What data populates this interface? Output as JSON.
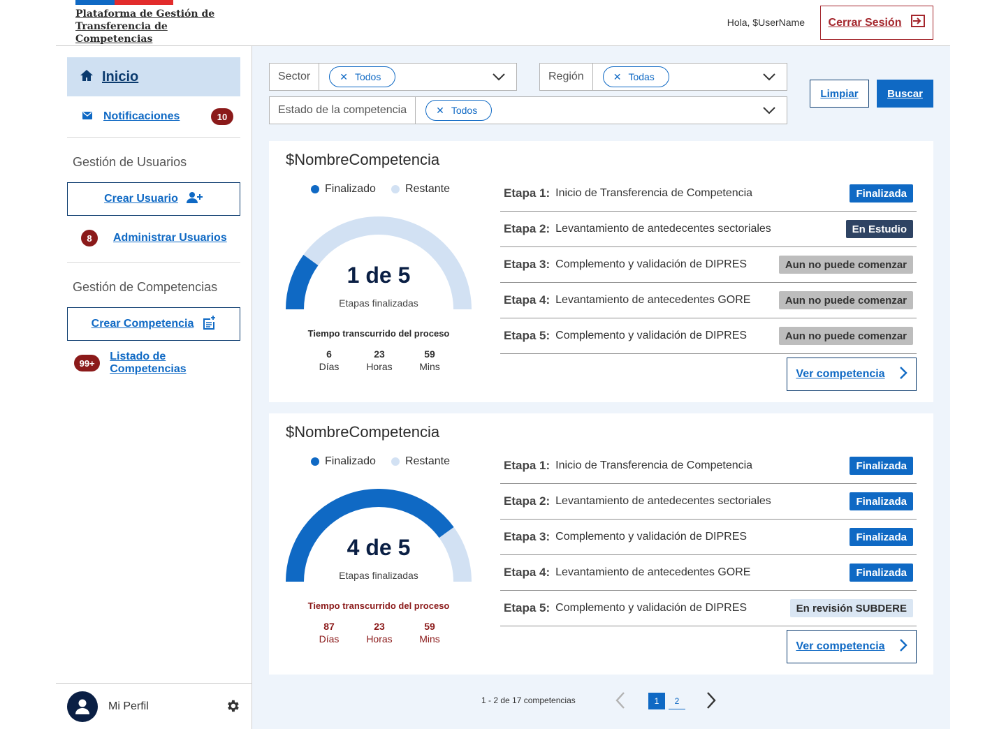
{
  "header": {
    "brand": "Plataforma de Gestión de Transferencia de Competencias",
    "greeting": "Hola, $UserName",
    "logout_label": "Cerrar Sesión"
  },
  "sidebar": {
    "home_label": "Inicio",
    "notifications_label": "Notificaciones",
    "notifications_count": "10",
    "users_section": "Gestión de Usuarios",
    "create_user_label": "Crear Usuario",
    "manage_users_label": "Administrar Usuarios",
    "manage_users_count": "8",
    "competencies_section": "Gestión de Competencias",
    "create_competency_label": "Crear Competencia",
    "list_competencies_label": "Listado de Competencias",
    "list_competencies_count": "99+",
    "profile_label": "Mi Perfil"
  },
  "filters": {
    "sector_label": "Sector",
    "sector_value": "Todos",
    "region_label": "Región",
    "region_value": "Todas",
    "estado_label": "Estado de la competencia",
    "estado_value": "Todos",
    "clear_label": "Limpiar",
    "search_label": "Buscar"
  },
  "legend": {
    "done": "Finalizado",
    "remaining": "Restante"
  },
  "colors": {
    "primary": "#0f69c4",
    "remaining": "#d2e1f3",
    "late": "#8b1a1a"
  },
  "cards": [
    {
      "title": "$NombreCompetencia",
      "progress_text": "1 de 5",
      "completed": 1,
      "total": 5,
      "progress_sub": "Etapas finalizadas",
      "time_title": "Tiempo transcurrido del proceso",
      "days": "6",
      "days_label": "Días",
      "hours": "23",
      "hours_label": "Horas",
      "mins": "59",
      "mins_label": "Mins",
      "stages": [
        {
          "num": "Etapa 1:",
          "desc": "Inicio de Transferencia de Competencia",
          "status": "Finalizada"
        },
        {
          "num": "Etapa 2:",
          "desc": "Levantamiento de antedecentes sectoriales",
          "status": "En Estudio"
        },
        {
          "num": "Etapa 3:",
          "desc": "Complemento y validación de DIPRES",
          "status": "Aun no puede comenzar"
        },
        {
          "num": "Etapa 4:",
          "desc": "Levantamiento de antecedentes GORE",
          "status": "Aun no puede comenzar"
        },
        {
          "num": "Etapa 5:",
          "desc": "Complemento y validación de DIPRES",
          "status": "Aun no puede comenzar"
        }
      ],
      "view_label": "Ver competencia"
    },
    {
      "title": "$NombreCompetencia",
      "progress_text": "4 de 5",
      "completed": 4,
      "total": 5,
      "progress_sub": "Etapas finalizadas",
      "time_title": "Tiempo transcurrido del proceso",
      "days": "87",
      "days_label": "Días",
      "hours": "23",
      "hours_label": "Horas",
      "mins": "59",
      "mins_label": "Mins",
      "stages": [
        {
          "num": "Etapa 1:",
          "desc": "Inicio de Transferencia de Competencia",
          "status": "Finalizada"
        },
        {
          "num": "Etapa 2:",
          "desc": "Levantamiento de antedecentes sectoriales",
          "status": "Finalizada"
        },
        {
          "num": "Etapa 3:",
          "desc": "Complemento y validación de DIPRES",
          "status": "Finalizada"
        },
        {
          "num": "Etapa 4:",
          "desc": "Levantamiento de antecedentes GORE",
          "status": "Finalizada"
        },
        {
          "num": "Etapa 5:",
          "desc": "Complemento y validación de DIPRES",
          "status": "En revisión SUBDERE"
        }
      ],
      "view_label": "Ver competencia"
    }
  ],
  "pagination": {
    "summary": "1 - 2 de 17 competencias",
    "page1": "1",
    "page2": "2"
  }
}
